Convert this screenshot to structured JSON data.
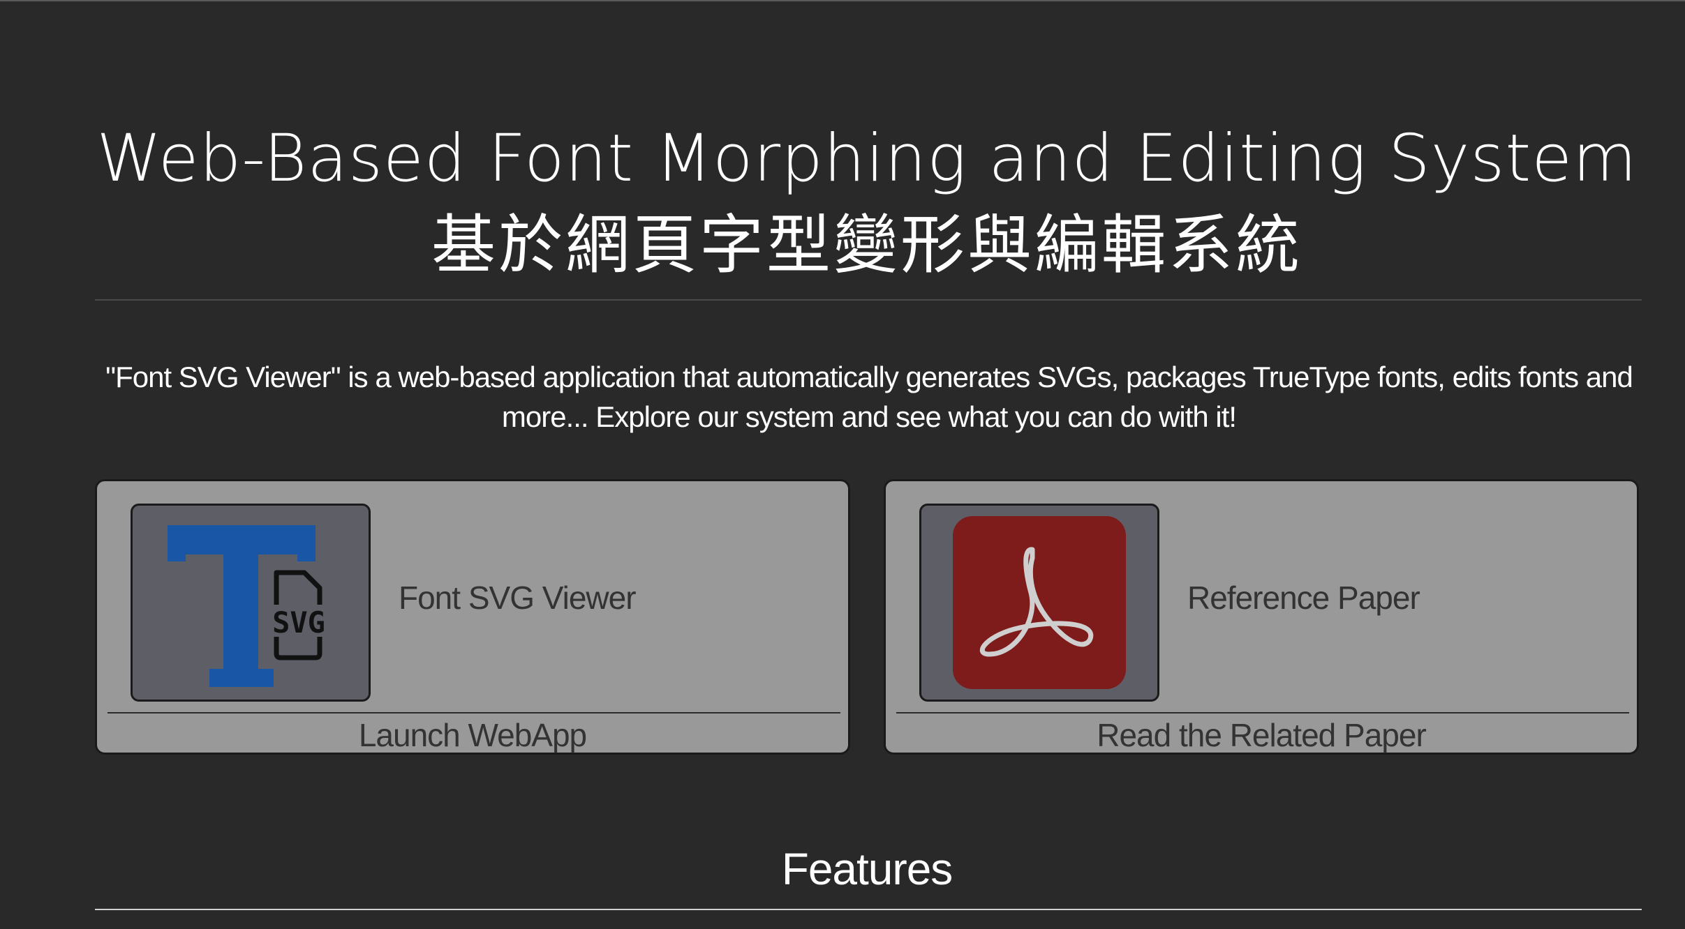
{
  "header": {
    "title_en": "Web-Based Font Morphing and Editing System",
    "title_zh": "基於網頁字型變形與編輯系統"
  },
  "intro": {
    "text": "\"Font SVG Viewer\" is a web-based application that automatically generates SVGs, packages TrueType fonts, edits fonts and more... Explore our system and see what you can do with it!"
  },
  "cards": [
    {
      "label": "Font SVG Viewer",
      "action": "Launch WebApp",
      "icon": "font-svg-icon",
      "svg_badge": "SVG",
      "accent": "#1a56a6"
    },
    {
      "label": "Reference Paper",
      "action": "Read the Related Paper",
      "icon": "pdf-icon",
      "accent": "#7e1b1b"
    }
  ],
  "features": {
    "heading": "Features"
  },
  "colors": {
    "background": "#292929",
    "card_bg": "#999999",
    "thumb_bg": "#5d5e66",
    "text_dark": "#333333"
  }
}
